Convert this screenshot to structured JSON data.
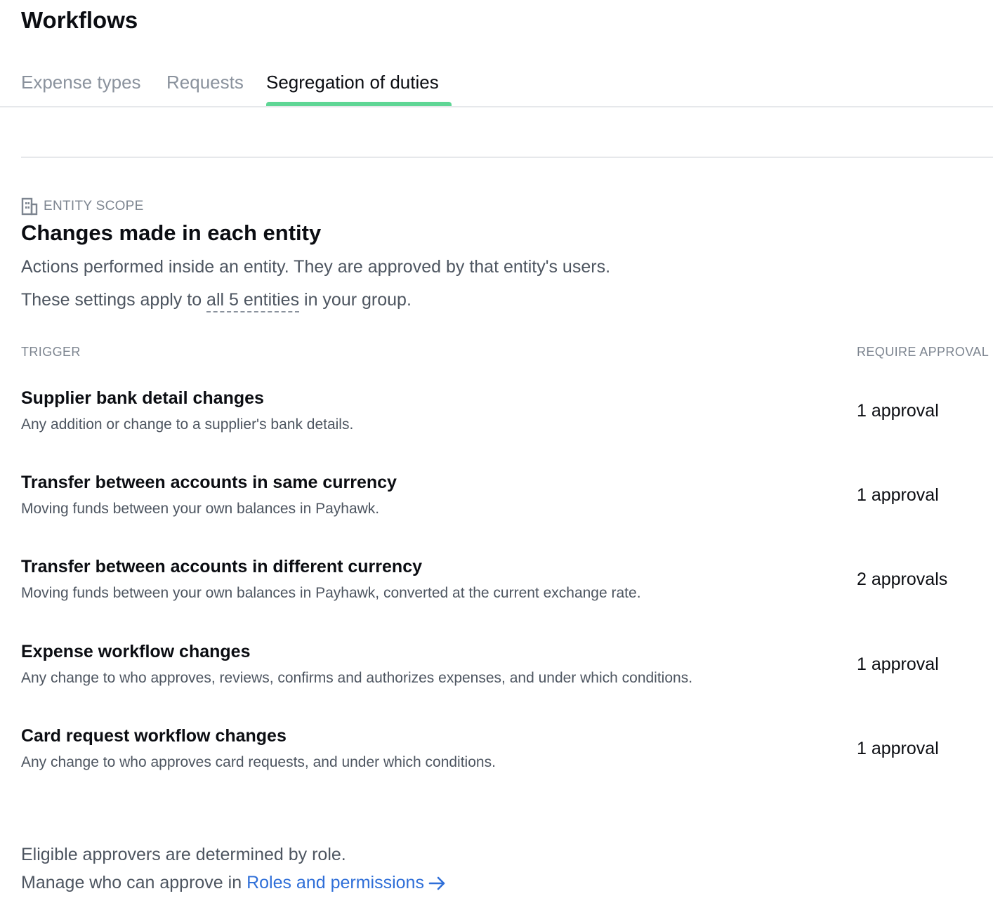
{
  "header": {
    "title": "Workflows"
  },
  "tabs": [
    {
      "label": "Expense types"
    },
    {
      "label": "Requests"
    },
    {
      "label": "Segregation of duties"
    }
  ],
  "active_tab": "Segregation of duties",
  "section": {
    "scope_icon": "building-icon",
    "scope_label": "ENTITY SCOPE",
    "title": "Changes made in each entity",
    "description": "Actions performed inside an entity. They are approved by that entity's users.",
    "note_prefix": "These settings apply to",
    "note_link": "all 5 entities",
    "note_suffix": "in your group."
  },
  "table": {
    "columns": {
      "trigger": "TRIGGER",
      "approval": "REQUIRE APPROVAL"
    },
    "rows": [
      {
        "title": "Supplier bank detail changes",
        "description": "Any addition or change to a supplier's bank details.",
        "approval": "1 approval"
      },
      {
        "title": "Transfer between accounts in same currency",
        "description": "Moving funds between your own balances in Payhawk.",
        "approval": "1 approval"
      },
      {
        "title": "Transfer between accounts in different currency",
        "description": "Moving funds between your own balances in Payhawk, converted at the current exchange rate.",
        "approval": "2 approvals"
      },
      {
        "title": "Expense workflow changes",
        "description": "Any change to who approves, reviews, confirms and authorizes expenses, and under which conditions.",
        "approval": "1 approval"
      },
      {
        "title": "Card request workflow changes",
        "description": "Any change to who approves card requests, and under which conditions.",
        "approval": "1 approval"
      }
    ]
  },
  "footer": {
    "line1": "Eligible approvers are determined by role.",
    "line2_prefix": "Manage who can approve in",
    "link_label": "Roles and permissions",
    "link_icon": "arrow-right-icon"
  },
  "colors": {
    "accent_tab": "#5fd695",
    "link": "#2f6fd8"
  }
}
